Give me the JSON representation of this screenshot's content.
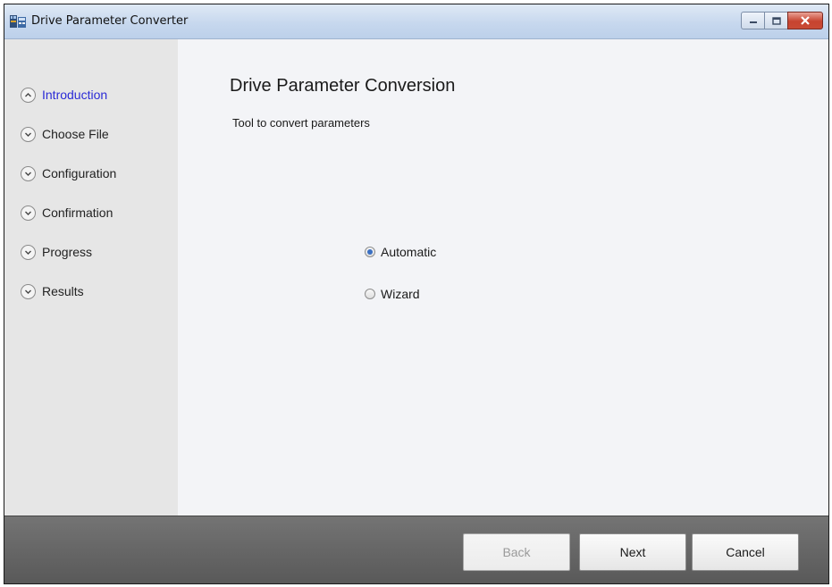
{
  "window": {
    "title": "Drive Parameter Converter",
    "accent_close": "#c7432f"
  },
  "sidebar": {
    "items": [
      {
        "label": "Introduction",
        "state": "active",
        "icon": "chevron-up-icon"
      },
      {
        "label": "Choose File",
        "state": "pending",
        "icon": "chevron-down-icon"
      },
      {
        "label": "Configuration",
        "state": "pending",
        "icon": "chevron-down-icon"
      },
      {
        "label": "Confirmation",
        "state": "pending",
        "icon": "chevron-down-icon"
      },
      {
        "label": "Progress",
        "state": "pending",
        "icon": "chevron-down-icon"
      },
      {
        "label": "Results",
        "state": "pending",
        "icon": "chevron-down-icon"
      }
    ],
    "active_color": "#2b2bd6"
  },
  "main": {
    "heading": "Drive Parameter Conversion",
    "subtitle": "Tool to convert parameters",
    "mode_options": [
      {
        "label": "Automatic",
        "checked": true
      },
      {
        "label": "Wizard",
        "checked": false
      }
    ]
  },
  "footer": {
    "back_label": "Back",
    "back_enabled": false,
    "next_label": "Next",
    "cancel_label": "Cancel"
  }
}
